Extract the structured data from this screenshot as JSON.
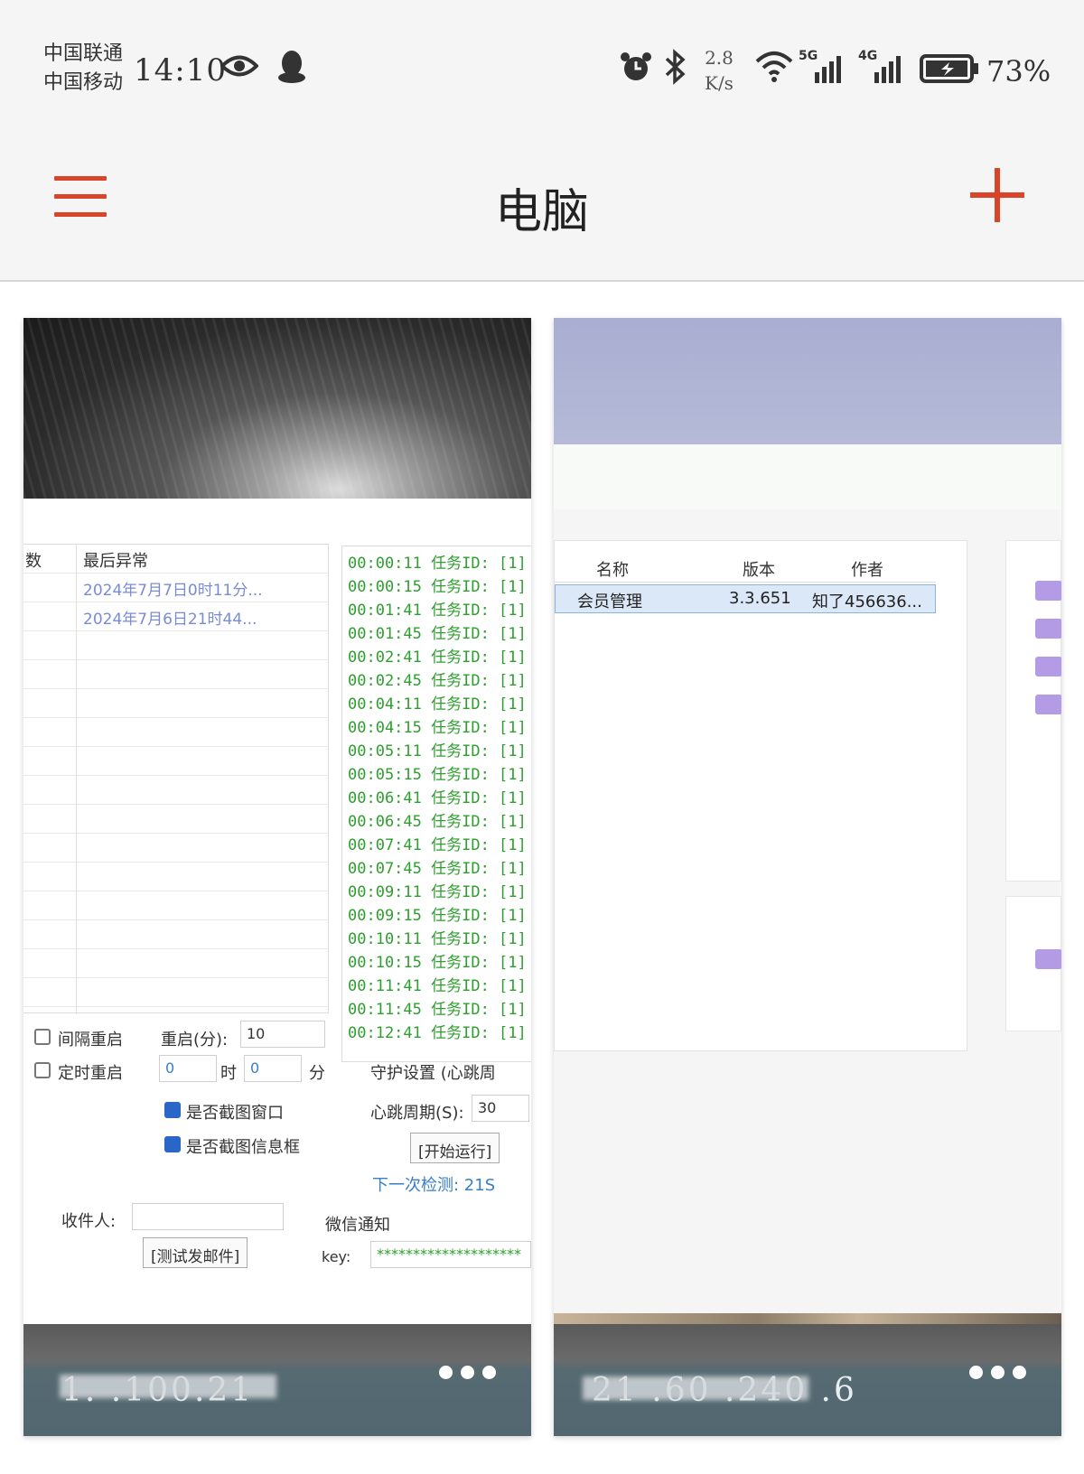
{
  "status_bar": {
    "carrier_1": "中国联通",
    "carrier_2": "中国移动",
    "time": "14:10",
    "net_speed_value": "2.8",
    "net_speed_unit": "K/s",
    "signal_1": "5G",
    "signal_2": "4G",
    "battery": "73%"
  },
  "app_bar": {
    "title": "电脑"
  },
  "devices": [
    {
      "ip_text": "1.   .100.21",
      "screen": {
        "grid_headers": [
          "数",
          "最后异常"
        ],
        "grid_links": [
          "2024年7月7日0时11分...",
          "2024年7月6日21时44..."
        ],
        "log_lines": [
          "00:00:11 任务ID: [1]",
          "00:00:15 任务ID: [1]",
          "00:01:41 任务ID: [1]",
          "00:01:45 任务ID: [1]",
          "00:02:41 任务ID: [1]",
          "00:02:45 任务ID: [1]",
          "00:04:11 任务ID: [1]",
          "00:04:15 任务ID: [1]",
          "00:05:11 任务ID: [1]",
          "00:05:15 任务ID: [1]",
          "00:06:41 任务ID: [1]",
          "00:06:45 任务ID: [1]",
          "00:07:41 任务ID: [1]",
          "00:07:45 任务ID: [1]",
          "00:09:11 任务ID: [1]",
          "00:09:15 任务ID: [1]",
          "00:10:11 任务ID: [1]",
          "00:10:15 任务ID: [1]",
          "00:11:41 任务ID: [1]",
          "00:11:45 任务ID: [1]",
          "00:12:41 任务ID: [1]"
        ],
        "interval_restart_label": "间隔重启",
        "restart_minutes_label": "重启(分):",
        "restart_minutes_value": "10",
        "timed_restart_label": "定时重启",
        "hour_value": "0",
        "hour_label": "时",
        "minute_value": "0",
        "minute_label": "分",
        "guard_settings_label": "守护设置 (心跳周",
        "capture_window_label": "是否截图窗口",
        "capture_message_label": "是否截图信息框",
        "heartbeat_label": "心跳周期(S):",
        "heartbeat_value": "30",
        "start_button": "[开始运行]",
        "next_check": "下一次检测: 21S",
        "recipient_label": "收件人:",
        "test_mail_button": "[测试发邮件]",
        "wechat_notify_label": "微信通知",
        "key_label": "key:",
        "key_value": "********************"
      }
    },
    {
      "ip_text": "21  .60  .240  .6",
      "screen": {
        "table_headers": [
          "名称",
          "版本",
          "作者"
        ],
        "row_name": "会员管理",
        "row_version": "3.3.651",
        "row_author": "知了456636..."
      }
    }
  ],
  "colors": {
    "accent": "#d9452a",
    "card_footer": "#526770",
    "log_green": "#2e9e2e"
  },
  "icons": {
    "menu": "hamburger-icon",
    "add": "plus-icon",
    "more": "more-dots-icon"
  }
}
